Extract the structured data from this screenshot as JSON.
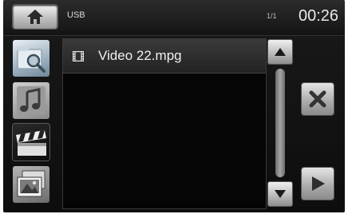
{
  "header": {
    "home_icon": "home-icon",
    "source": "USB",
    "page_indicator": "1/1",
    "clock": "00:26"
  },
  "categories": [
    {
      "name": "search",
      "icon": "folder-search-icon"
    },
    {
      "name": "music",
      "icon": "music-note-icon"
    },
    {
      "name": "video",
      "icon": "clapperboard-icon",
      "selected": true
    },
    {
      "name": "photo",
      "icon": "photo-stack-icon"
    }
  ],
  "file_list": {
    "items": [
      {
        "label": "Video 22.mpg",
        "icon": "film-icon"
      }
    ]
  },
  "scrollbar": {
    "up_icon": "triangle-up-icon",
    "down_icon": "triangle-down-icon"
  },
  "actions": {
    "close_icon": "close-icon",
    "play_icon": "play-icon"
  },
  "colors": {
    "background": "#0d0d0d",
    "button_light": "#e5e5e5",
    "text": "#f0f0f0"
  }
}
